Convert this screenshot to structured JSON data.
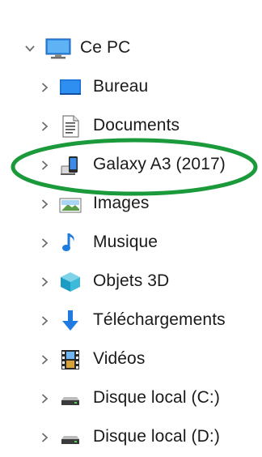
{
  "tree": {
    "root": {
      "label": "Ce PC",
      "icon": "this-pc-monitor-icon",
      "expanded": true
    },
    "children": [
      {
        "label": "Bureau",
        "icon": "desktop-folder-icon"
      },
      {
        "label": "Documents",
        "icon": "documents-folder-icon"
      },
      {
        "label": "Galaxy A3 (2017)",
        "icon": "portable-device-icon"
      },
      {
        "label": "Images",
        "icon": "pictures-folder-icon"
      },
      {
        "label": "Musique",
        "icon": "music-note-icon"
      },
      {
        "label": "Objets 3D",
        "icon": "3d-objects-cube-icon"
      },
      {
        "label": "Téléchargements",
        "icon": "download-arrow-icon"
      },
      {
        "label": "Vidéos",
        "icon": "video-film-icon"
      },
      {
        "label": "Disque local (C:)",
        "icon": "local-drive-icon"
      },
      {
        "label": "Disque local (D:)",
        "icon": "local-drive-icon"
      }
    ]
  },
  "annotation": {
    "shape": "ellipse",
    "color": "#1a9a3a",
    "highlighted_item": "Galaxy A3 (2017)"
  },
  "colors": {
    "chevron": "#6e6e6e",
    "folder_blue": "#1a73e8",
    "text": "#1a1a1a"
  }
}
